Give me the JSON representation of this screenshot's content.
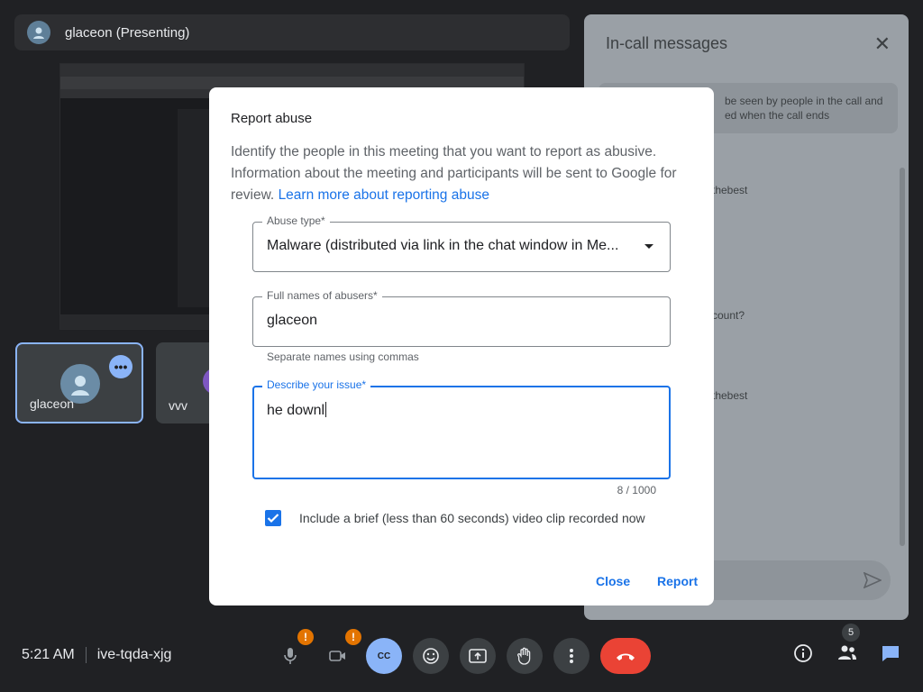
{
  "presenter": {
    "name": "glaceon (Presenting)",
    "avatar_icon": "user-avatar"
  },
  "participants": [
    {
      "name": "glaceon",
      "avatar_icon": "user-avatar",
      "more_icon": "more-horiz-icon"
    },
    {
      "name": "vvv",
      "avatar_icon": "user-avatar"
    }
  ],
  "side_panel": {
    "title": "In-call messages",
    "close_icon": "close-icon",
    "notice_line1": "be seen by people in the call and",
    "notice_line2": "ed when the call ends",
    "msg1": "thebest",
    "msg2": "count?",
    "msg3": "thebest",
    "send_icon": "send-icon"
  },
  "dialog": {
    "title": "Report abuse",
    "description": "Identify the people in this meeting that you want to report as abusive. Information about the meeting and participants will be sent to Google for review.",
    "learn_more": "Learn more about reporting abuse",
    "abuse_type": {
      "label": "Abuse type*",
      "value": "Malware (distributed via link in the chat window in Me..."
    },
    "names": {
      "label": "Full names of abusers*",
      "value": "glaceon",
      "helper": "Separate names using commas"
    },
    "issue": {
      "label": "Describe your issue*",
      "value": "he downl",
      "counter": "8 / 1000"
    },
    "checkbox": {
      "label": "Include a brief (less than 60 seconds) video clip recorded now",
      "checked": true
    },
    "close_label": "Close",
    "report_label": "Report"
  },
  "bottom_bar": {
    "time": "5:21 AM",
    "meeting_code": "ive-tqda-xjg",
    "warning_badge": "!",
    "captions_label": "CC",
    "people_count": "5"
  },
  "colors": {
    "accent": "#1a73e8",
    "hangup": "#ea4335",
    "warning": "#e37400",
    "selected_tile": "#8ab4f8"
  }
}
